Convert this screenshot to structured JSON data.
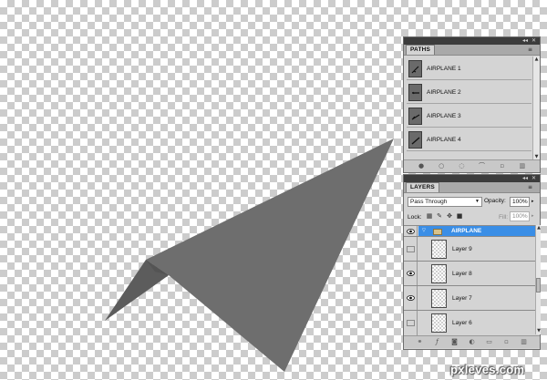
{
  "paths_panel": {
    "tab_label": "PATHS",
    "top_controls": [
      "◂◂",
      "x"
    ],
    "menu_icon": "panel-menu-icon",
    "items": [
      {
        "label": "AIRPLANE 1"
      },
      {
        "label": "AIRPLANE 2"
      },
      {
        "label": "AIRPLANE 3"
      },
      {
        "label": "AIRPLANE 4"
      }
    ],
    "footer_icons": [
      "fill-path-icon",
      "stroke-path-icon",
      "load-selection-icon",
      "make-work-path-icon",
      "new-path-icon",
      "delete-path-icon"
    ]
  },
  "layers_panel": {
    "tab_label": "LAYERS",
    "top_controls": [
      "◂◂",
      "x"
    ],
    "blend_mode": "Pass Through",
    "opacity_label": "Opacity:",
    "opacity_value": "100%",
    "lock_label": "Lock:",
    "fill_label": "Fill:",
    "fill_value": "100%",
    "group": {
      "name": "AIRPLANE",
      "expanded": true,
      "visible": true,
      "selected": true
    },
    "layers": [
      {
        "name": "Layer 9",
        "visible": false
      },
      {
        "name": "Layer 8",
        "visible": true
      },
      {
        "name": "Layer 7",
        "visible": true
      },
      {
        "name": "Layer 6",
        "visible": false
      }
    ],
    "footer_icons": [
      "link-layers-icon",
      "fx-icon",
      "add-mask-icon",
      "adjustment-layer-icon",
      "new-group-icon",
      "new-layer-icon",
      "delete-layer-icon"
    ]
  },
  "canvas": {
    "shape": "paper airplane",
    "shape_color": "#6e6e6e"
  },
  "watermark": "pxleves.com",
  "colors": {
    "selection": "#3a8ee6",
    "panel_bg": "#d4d4d4",
    "panel_header": "#3c3c3c"
  }
}
